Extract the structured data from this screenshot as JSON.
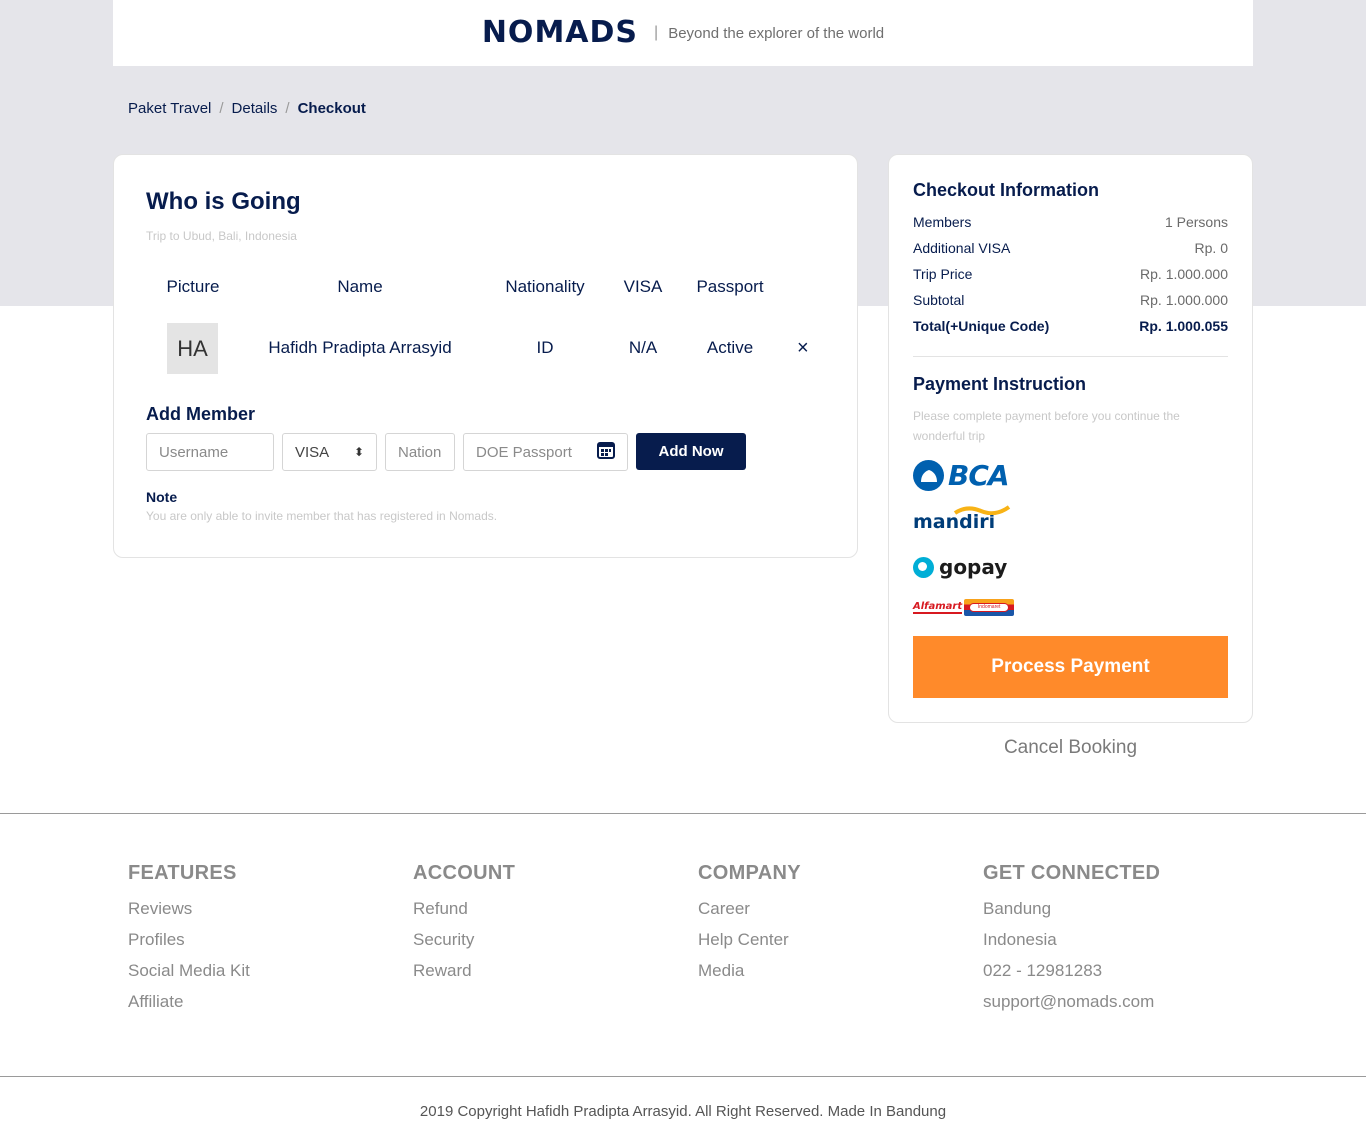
{
  "header": {
    "logo_text": "NOMADS",
    "separator": "|",
    "tagline": "Beyond the explorer of the world"
  },
  "breadcrumb": {
    "items": [
      "Paket Travel",
      "Details",
      "Checkout"
    ],
    "separator": "/"
  },
  "who_is_going": {
    "title": "Who is Going",
    "subtitle": "Trip to Ubud, Bali, Indonesia",
    "columns": [
      "Picture",
      "Name",
      "Nationality",
      "VISA",
      "Passport"
    ],
    "members": [
      {
        "initials": "HA",
        "name": "Hafidh Pradipta Arrasyid",
        "nationality": "ID",
        "visa": "N/A",
        "passport": "Active",
        "remove_icon": "×"
      }
    ]
  },
  "add_member": {
    "title": "Add Member",
    "username_placeholder": "Username",
    "visa_selected": "VISA",
    "visa_arrow": "⬍",
    "nation_placeholder": "Nation",
    "doe_placeholder": "DOE Passport",
    "add_button": "Add Now",
    "note_title": "Note",
    "note_text": "You are only able to invite member that has registered in Nomads."
  },
  "checkout": {
    "title": "Checkout Information",
    "rows": [
      {
        "label": "Members",
        "value": "1 Persons"
      },
      {
        "label": "Additional VISA",
        "value": "Rp. 0"
      },
      {
        "label": "Trip Price",
        "value": "Rp. 1.000.000"
      },
      {
        "label": "Subtotal",
        "value": "Rp. 1.000.000"
      },
      {
        "label": "Total(+Unique Code)",
        "value": "Rp. 1.000.055"
      }
    ]
  },
  "payment": {
    "title": "Payment Instruction",
    "subtitle": "Please complete payment before you continue the wonderful trip",
    "methods": {
      "bca": "BCA",
      "mandiri": "mandiri",
      "gopay": "gopay",
      "alfamart": "Alfamart",
      "indomaret": "Indomaret"
    },
    "process_button": "Process Payment",
    "cancel": "Cancel Booking"
  },
  "footer": {
    "columns": [
      {
        "title": "FEATURES",
        "items": [
          "Reviews",
          "Profiles",
          "Social Media Kit",
          "Affiliate"
        ]
      },
      {
        "title": "ACCOUNT",
        "items": [
          "Refund",
          "Security",
          "Reward"
        ]
      },
      {
        "title": "COMPANY",
        "items": [
          "Career",
          "Help Center",
          "Media"
        ]
      },
      {
        "title": "GET CONNECTED",
        "items": [
          "Bandung",
          "Indonesia",
          "022 - 12981283",
          "support@nomads.com"
        ]
      }
    ],
    "copyright": "2019 Copyright Hafidh Pradipta Arrasyid. All Right Reserved. Made In Bandung"
  },
  "colors": {
    "primary": "#071C4D",
    "accent": "#FF8A2A",
    "band": "#E5E5EA"
  }
}
